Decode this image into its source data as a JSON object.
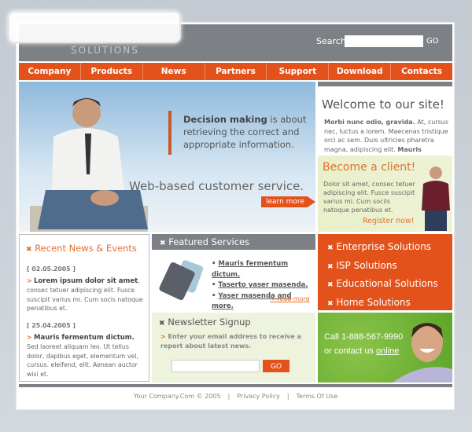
{
  "header": {
    "logo_text": "SOLUTIONS",
    "search_label": "Search",
    "search_value": "",
    "search_go": "GO"
  },
  "nav": [
    "Company",
    "Products",
    "News",
    "Partners",
    "Support",
    "Download",
    "Contacts"
  ],
  "hero": {
    "quote_bold": "Decision making",
    "quote_rest": " is about retrieving the correct and appropriate information.",
    "tagline": "Web-based customer service.",
    "learn_more": "learn more"
  },
  "welcome": {
    "title": "Welcome to our site!",
    "bold": "Morbi nunc odio, gravida.",
    "text": " At, cursus nec, luctus a lorem. Maecenas tristique orci ac sem. Duis ultricies pharetra magna, adipiscing elit. ",
    "bold_end": "Mauris"
  },
  "client": {
    "title": "Become a client!",
    "text": "Dolor sit amet, consec tetuer adipiscing elit. Fusce suscipit varius mi. Cum sociis natoque penatibus et.",
    "register": "Register now!"
  },
  "news": {
    "title": "Recent News & Events",
    "items": [
      {
        "date": "[ 02.05.2005 ]",
        "headline": "Lorem ipsum dolor sit amet",
        "text": ", consec tetuer adipiscing elit. Fusce suscipit varius mi. Cum socis natoque penatibus et."
      },
      {
        "date": "[ 25.04.2005 ]",
        "headline": "Mauris fermentum dictum.",
        "text": " Sed laoreet aliquam leo. Ut tellus dolor, dapibus eget, elementum vel, cursus. eleifend, elit. Aenean auctor wisi et."
      }
    ]
  },
  "featured": {
    "title": "Featured Services",
    "links": [
      "Mauris fermentum dictum.",
      "Taserto yaser masenda.",
      "Yaser masenda and more."
    ],
    "read_more": "read more"
  },
  "newsletter": {
    "title": "Newsletter Signup",
    "text": "Enter your email address to receive a report about latest news.",
    "input_value": "",
    "go": "GO"
  },
  "solutions": [
    "Enterprise Solutions",
    "ISP Solutions",
    "Educational Solutions",
    "Home Solutions"
  ],
  "call": {
    "line1": "Call 1-888-567-9990",
    "line2_prefix": "or contact us ",
    "line2_link": "online"
  },
  "footer": {
    "copyright": "Your Company.Com © 2005",
    "privacy": "Privacy Policy",
    "terms": "Terms Of Use",
    "separator": "|"
  },
  "colors": {
    "orange": "#e4521c",
    "gray": "#7d8186",
    "green": "#6ab531"
  }
}
